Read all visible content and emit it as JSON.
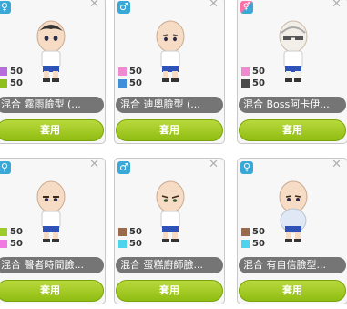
{
  "cards": [
    {
      "gender": "♀",
      "name": "混合 霧雨臉型 (...",
      "apply": "套用",
      "c1": {
        "value": "50",
        "color": "#b76ddb"
      },
      "c2": {
        "value": "50",
        "color": "#8fbf1d"
      }
    },
    {
      "gender": "♂",
      "name": "混合 迪奧臉型 (...",
      "apply": "套用",
      "c1": {
        "value": "50",
        "color": "#f08ad0"
      },
      "c2": {
        "value": "50",
        "color": "#3e8fd8"
      }
    },
    {
      "gender": "⚥",
      "name": "混合 Boss阿卡伊...",
      "apply": "套用",
      "c1": {
        "value": "50",
        "color": "#f08ad0"
      },
      "c2": {
        "value": "50",
        "color": "#4a4a4a"
      }
    },
    {
      "gender": "♀",
      "name": "混合 醫者時間臉...",
      "apply": "套用",
      "c1": {
        "value": "50",
        "color": "#9dcc2a"
      },
      "c2": {
        "value": "50",
        "color": "#f07ae0"
      }
    },
    {
      "gender": "♂",
      "name": "混合 蛋糕廚師臉...",
      "apply": "套用",
      "c1": {
        "value": "50",
        "color": "#9a6a4d"
      },
      "c2": {
        "value": "50",
        "color": "#4ed3ec"
      }
    },
    {
      "gender": "♀",
      "name": "混合 有自信臉型...",
      "apply": "套用",
      "c1": {
        "value": "50",
        "color": "#9a6a4d"
      },
      "c2": {
        "value": "50",
        "color": "#4ed3ec"
      }
    }
  ]
}
